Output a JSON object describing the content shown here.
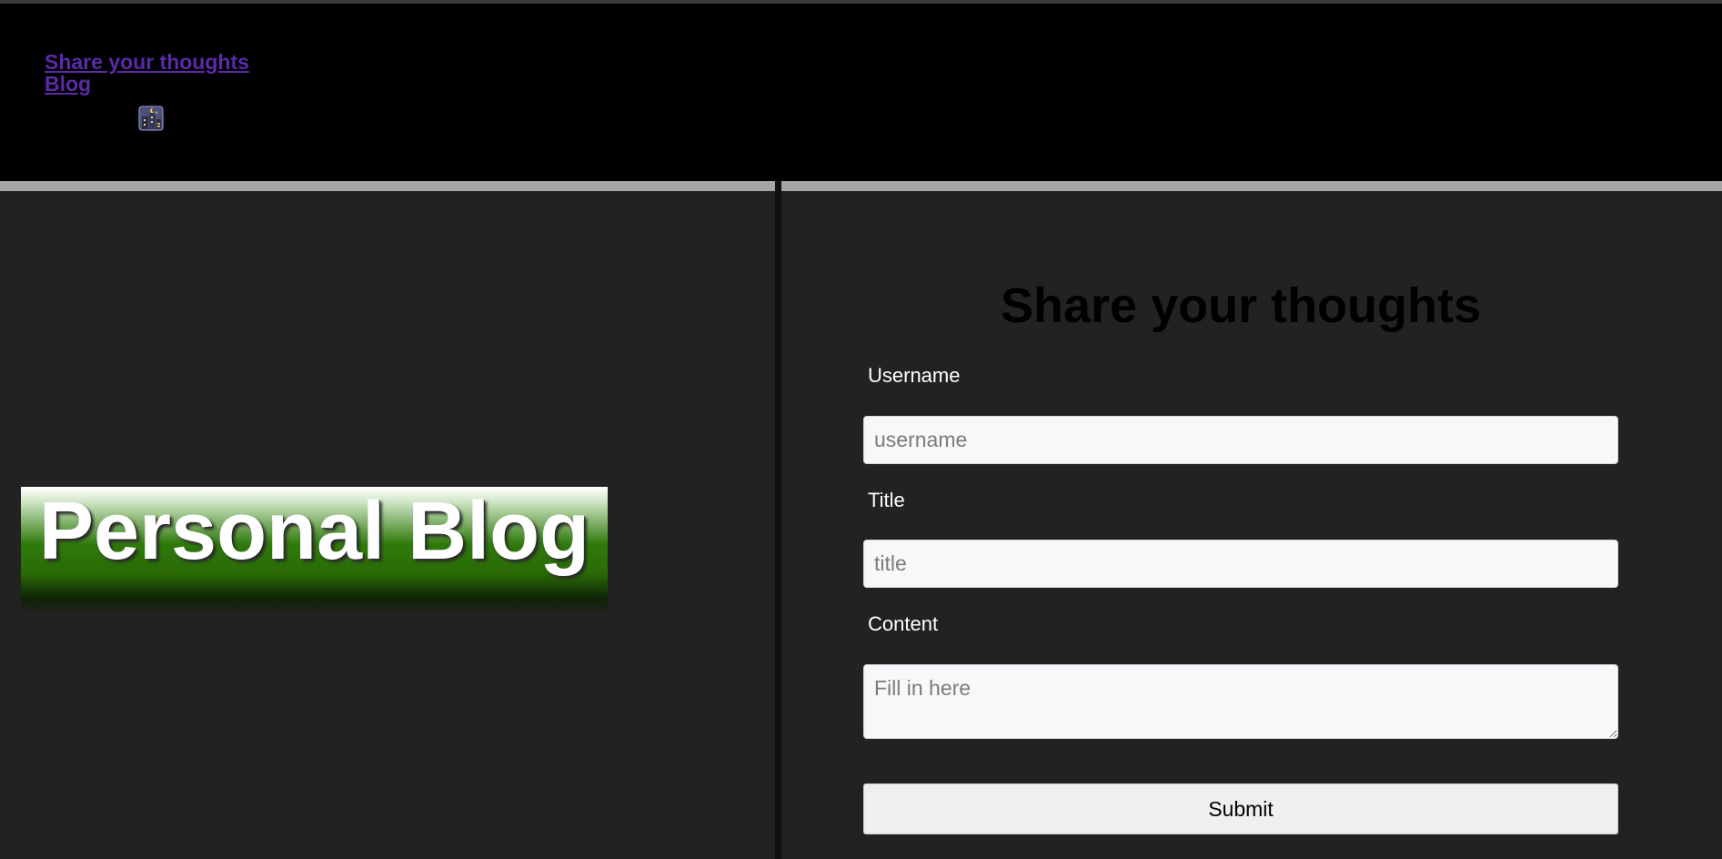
{
  "nav": {
    "links": [
      {
        "label": "Share your thoughts"
      },
      {
        "label": "Blog"
      }
    ],
    "logo_icon": "city-night-icon"
  },
  "left": {
    "banner_text": "Personal Blog"
  },
  "form": {
    "title": "Share your thoughts",
    "username_label": "Username",
    "username_placeholder": "username",
    "title_label": "Title",
    "title_placeholder": "title",
    "content_label": "Content",
    "content_placeholder": "Fill in here",
    "submit_label": "Submit"
  },
  "colors": {
    "header_bg": "#000000",
    "page_bg": "#222222",
    "link": "#5b2aa8",
    "banner_green": "#2f7a0b",
    "input_bg": "#f7f8fa"
  }
}
